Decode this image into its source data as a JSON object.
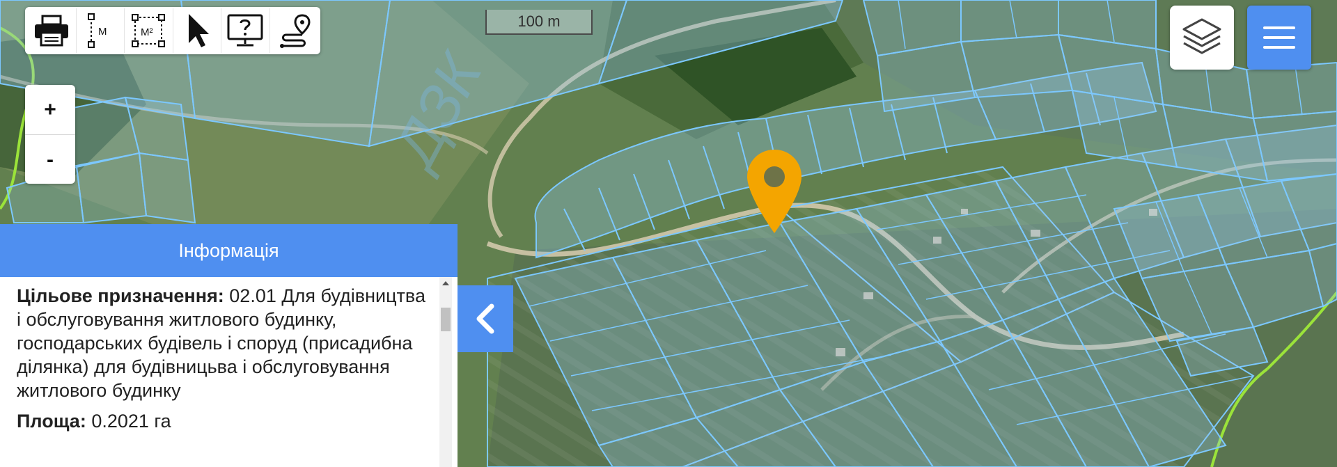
{
  "toolbar": {
    "tools": [
      {
        "name": "print-icon"
      },
      {
        "name": "measure-length-icon",
        "label": "M"
      },
      {
        "name": "measure-area-icon",
        "label": "M²"
      },
      {
        "name": "cursor-icon"
      },
      {
        "name": "help-monitor-icon"
      },
      {
        "name": "route-icon"
      }
    ]
  },
  "scale": {
    "label": "100 m"
  },
  "zoom": {
    "in_label": "+",
    "out_label": "-"
  },
  "map": {
    "watermark": "ДЗК"
  },
  "panel": {
    "title": "Інформація",
    "purpose_label": "Цільове призначення:",
    "purpose_value": "02.01 Для будівництва і обслуговування житлового будинку, господарських будівель і споруд (присадибна ділянка) для будівницьва і обслуговування житлового будинку",
    "area_label": "Площа:",
    "area_value": "0.2021 га"
  },
  "colors": {
    "accent": "#4f8ff0",
    "marker": "#f4a500",
    "parcel_border": "#7cc8ff",
    "boundary_line": "#9be33a"
  },
  "icons": {
    "layers": "layers-icon",
    "menu": "hamburger-menu-icon",
    "collapse": "chevron-left-icon",
    "marker": "map-marker-icon"
  }
}
